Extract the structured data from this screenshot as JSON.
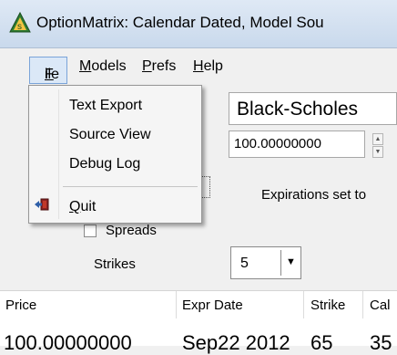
{
  "window": {
    "title": "OptionMatrix: Calendar Dated, Model Sou",
    "icon": "app-logo-icon"
  },
  "menubar": {
    "items": [
      {
        "label": "File",
        "accel": "F"
      },
      {
        "label": "Models",
        "accel": "M"
      },
      {
        "label": "Prefs",
        "accel": "P"
      },
      {
        "label": "Help",
        "accel": "H"
      }
    ]
  },
  "file_menu": {
    "items": [
      "Text Export",
      "Source View",
      "Debug Log"
    ],
    "quit": {
      "label": "Quit",
      "icon": "exit-door-icon"
    }
  },
  "form": {
    "model": "Black-Scholes",
    "price": "100.00000000",
    "expirations_text": "Expirations set to",
    "spreads_label": "Spreads",
    "strikes_label": "Strikes",
    "strikes_value": "5"
  },
  "table": {
    "headers": [
      "Price",
      "Expr Date",
      "Strike",
      "Cal"
    ],
    "rows": [
      [
        "100.00000000",
        "Sep22 2012",
        "65",
        "35"
      ]
    ]
  },
  "colors": {
    "menu_highlight": "#dbe8f7",
    "menu_highlight_border": "#7aa4d9"
  }
}
